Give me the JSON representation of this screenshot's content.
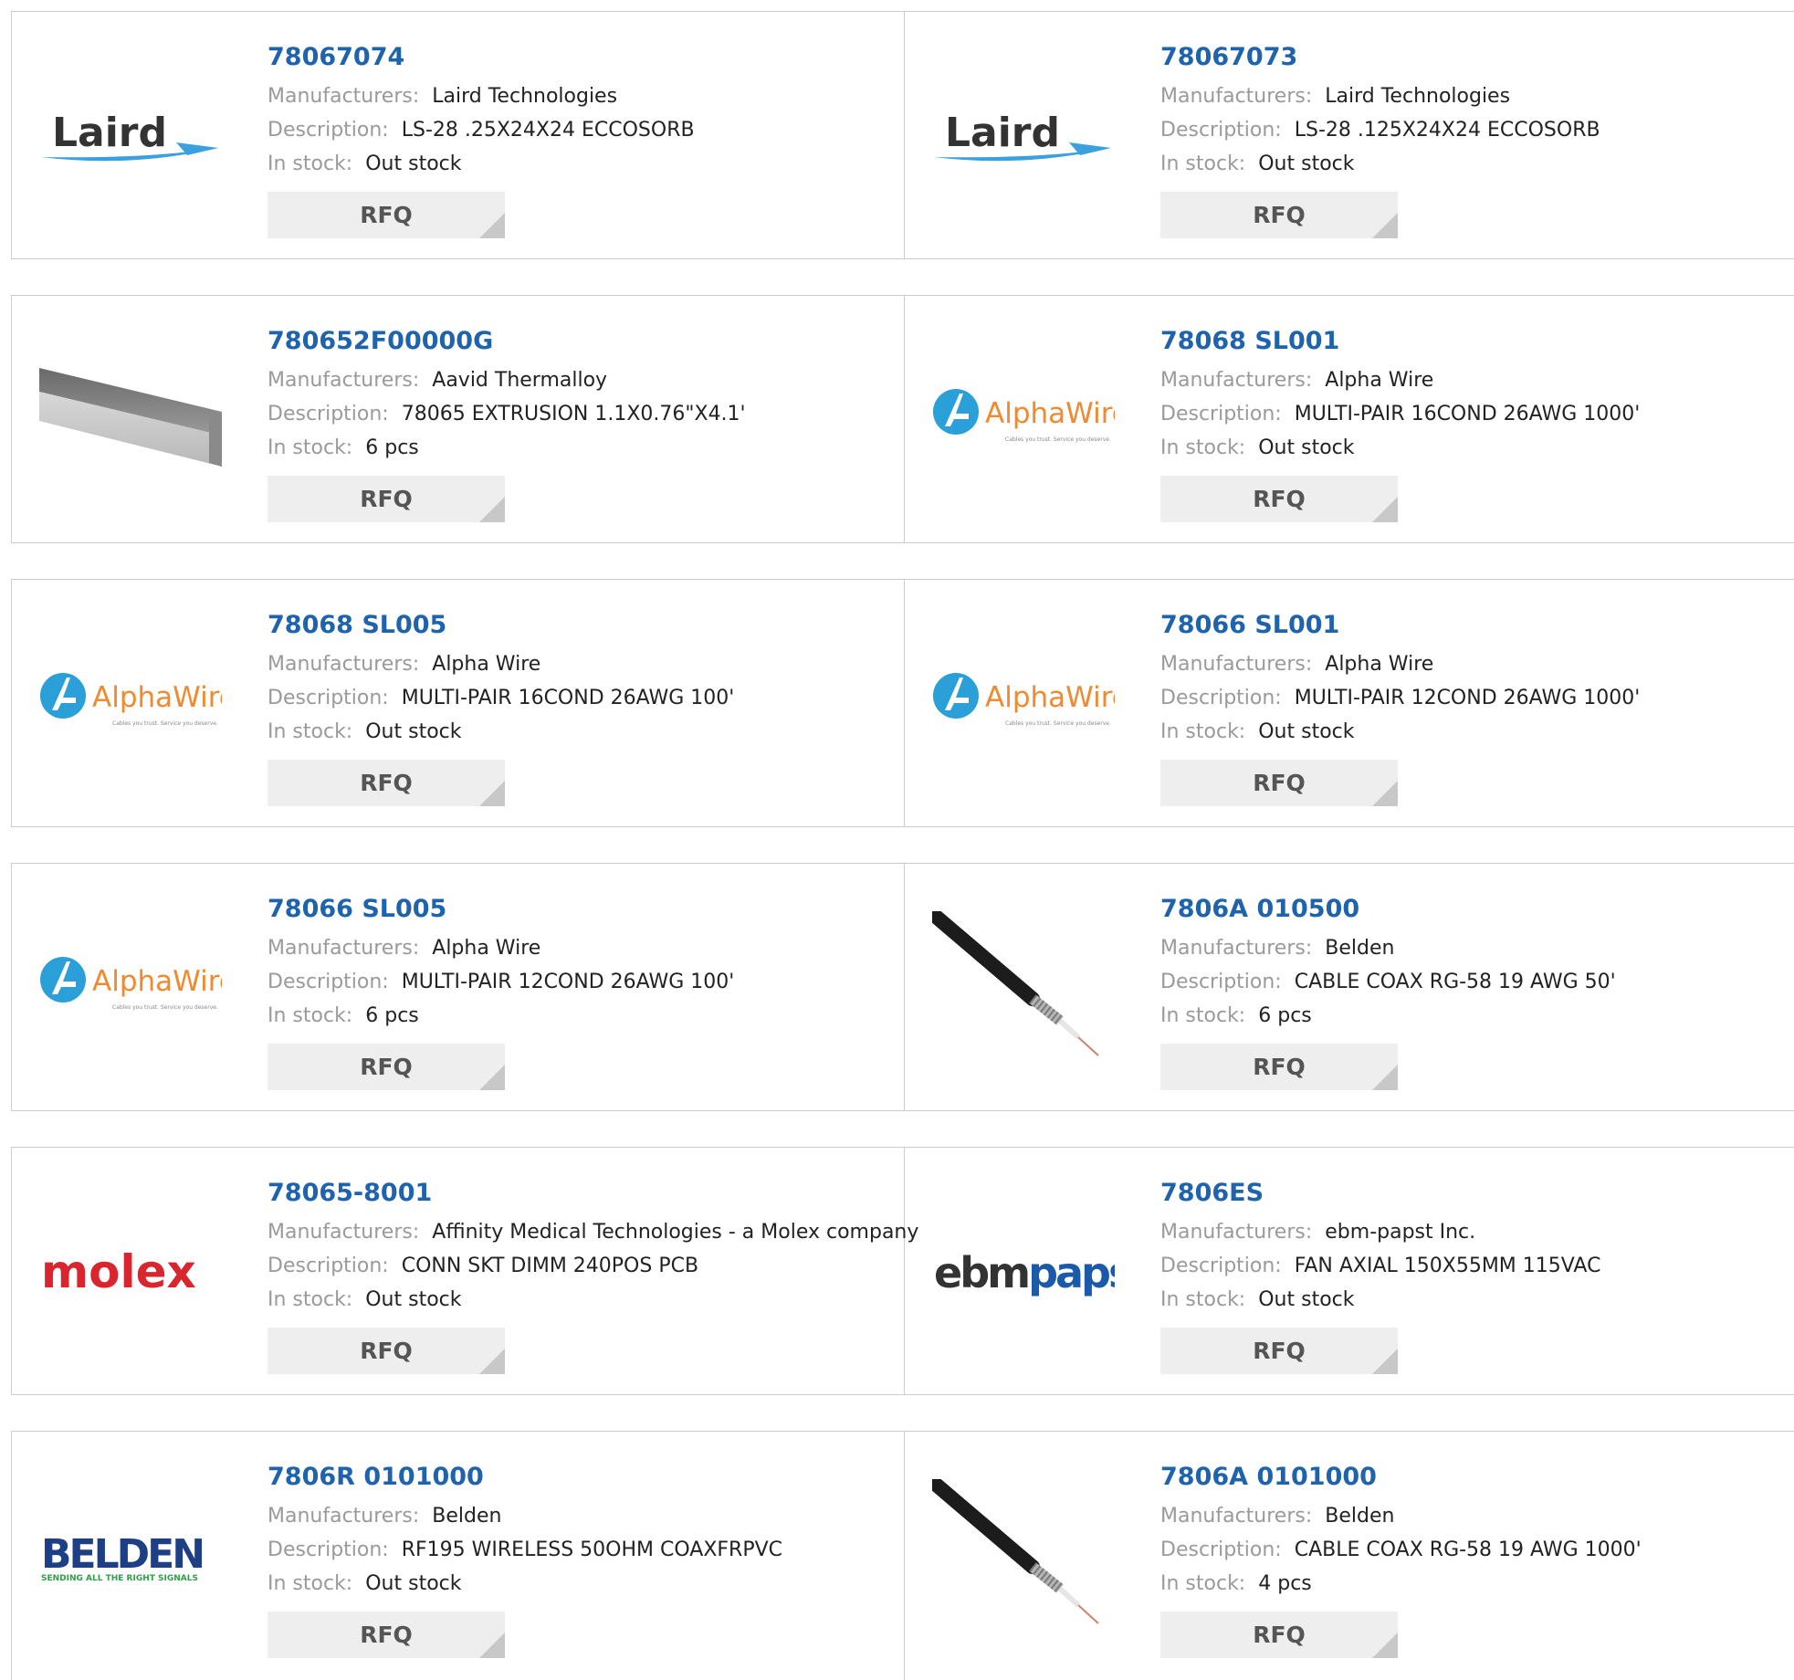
{
  "labels": {
    "manufacturers": "Manufacturers:",
    "description": "Description:",
    "in_stock": "In stock:",
    "rfq": "RFQ"
  },
  "logos": {
    "laird": "Laird",
    "alphawire": "AlphaWire",
    "alphawire_tagline": "Cables you trust. Service you deserve.",
    "molex": "molex",
    "ebm": "ebm",
    "papst": "papst",
    "belden": "BELDEN",
    "belden_tagline": "SENDING ALL THE RIGHT SIGNALS"
  },
  "colors": {
    "link": "#1f63ad",
    "laird_swoosh": "#3aa0e0",
    "alphawire_blue": "#2a9fd8",
    "alphawire_orange": "#f08a30",
    "molex_red": "#d9262e",
    "ebm_blue": "#1b5aa8",
    "belden_navy": "#1d3f86",
    "belden_green": "#2e9e48",
    "rfq_bg": "#eeeeee"
  },
  "products": [
    {
      "part": "78067074",
      "manufacturer": "Laird Technologies",
      "description": "LS-28 .25X24X24 ECCOSORB",
      "stock": "Out stock",
      "logo": "laird-logo"
    },
    {
      "part": "78067073",
      "manufacturer": "Laird Technologies",
      "description": "LS-28 .125X24X24 ECCOSORB",
      "stock": "Out stock",
      "logo": "laird-logo"
    },
    {
      "part": "780652F00000G",
      "manufacturer": "Aavid Thermalloy",
      "description": "78065 EXTRUSION 1.1X0.76\"X4.1'",
      "stock": "6 pcs",
      "logo": "extrusion-image"
    },
    {
      "part": "78068 SL001",
      "manufacturer": "Alpha Wire",
      "description": "MULTI-PAIR 16COND 26AWG 1000'",
      "stock": "Out stock",
      "logo": "alphawire-logo"
    },
    {
      "part": "78068 SL005",
      "manufacturer": "Alpha Wire",
      "description": "MULTI-PAIR 16COND 26AWG 100'",
      "stock": "Out stock",
      "logo": "alphawire-logo"
    },
    {
      "part": "78066 SL001",
      "manufacturer": "Alpha Wire",
      "description": "MULTI-PAIR 12COND 26AWG 1000'",
      "stock": "Out stock",
      "logo": "alphawire-logo"
    },
    {
      "part": "78066 SL005",
      "manufacturer": "Alpha Wire",
      "description": "MULTI-PAIR 12COND 26AWG 100'",
      "stock": "6 pcs",
      "logo": "alphawire-logo"
    },
    {
      "part": "7806A 010500",
      "manufacturer": "Belden",
      "description": "CABLE COAX RG-58 19 AWG 50'",
      "stock": "6 pcs",
      "logo": "coax-cable-image"
    },
    {
      "part": "78065-8001",
      "manufacturer": "Affinity Medical Technologies - a Molex company",
      "description": "CONN SKT DIMM 240POS PCB",
      "stock": "Out stock",
      "logo": "molex-logo"
    },
    {
      "part": "7806ES",
      "manufacturer": "ebm-papst Inc.",
      "description": "FAN AXIAL 150X55MM 115VAC",
      "stock": "Out stock",
      "logo": "ebmpapst-logo"
    },
    {
      "part": "7806R 0101000",
      "manufacturer": "Belden",
      "description": "RF195 WIRELESS 50OHM COAXFRPVC",
      "stock": "Out stock",
      "logo": "belden-logo"
    },
    {
      "part": "7806A 0101000",
      "manufacturer": "Belden",
      "description": "CABLE COAX RG-58 19 AWG 1000'",
      "stock": "4 pcs",
      "logo": "coax-cable-image"
    }
  ]
}
